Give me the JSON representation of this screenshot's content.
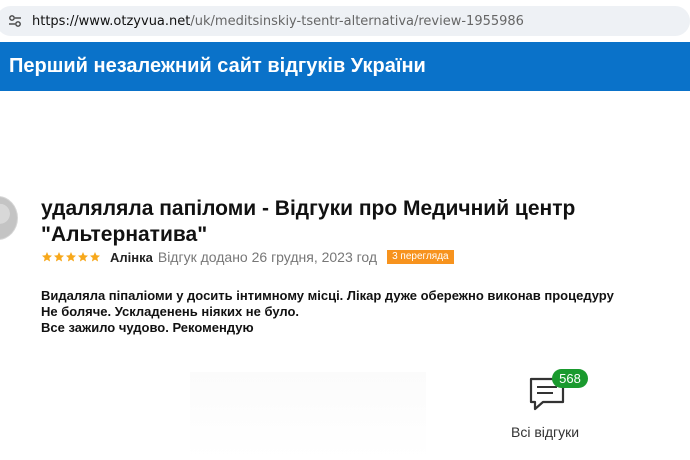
{
  "browser": {
    "url_host": "https://www.otzyvua.net",
    "url_path": "/uk/meditsinskiy-tsentr-alternativa/review-1955986"
  },
  "banner": {
    "title": "Перший незалежний сайт відгуків України",
    "color": "#0a72c9"
  },
  "review": {
    "title": "удаляляла папіломи - Відгуки про Медичний центр \"Альтернатива\"",
    "rating": 5,
    "rating_max": 5,
    "author": "Алінка",
    "added": "Відгук додано 26 грудня, 2023 год",
    "views_badge": "3 перегляда",
    "body": [
      "Видаляла піпаліоми у досить інтимному місці. Лікар дуже обережно виконав процедуру",
      "Не боляче. Ускладенень ніяких не було.",
      "Все зажило чудово. Рекомендую"
    ]
  },
  "all_reviews": {
    "count": "568",
    "label": "Всі відгуки",
    "badge_color": "#1a9a2e"
  }
}
